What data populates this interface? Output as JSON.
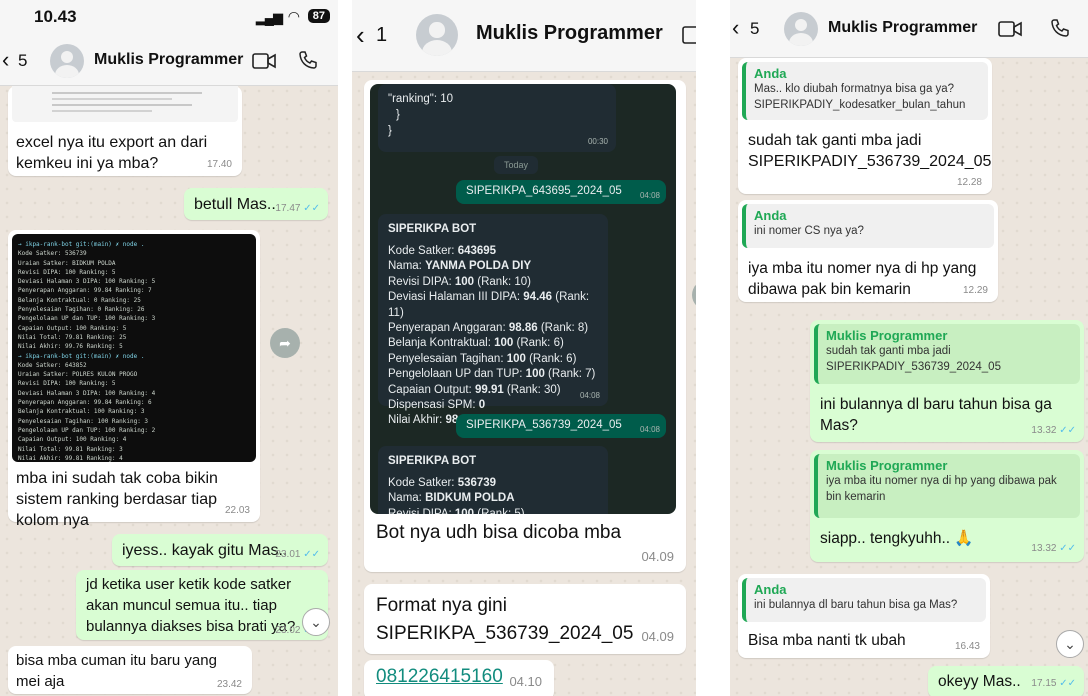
{
  "status": {
    "time": "10.43",
    "battery": "87"
  },
  "panel1": {
    "header": {
      "back_count": "5",
      "name": "Muklis Programmer"
    },
    "messages": {
      "m1": "excel nya itu export an dari kemkeu ini ya mba?",
      "m1_time": "17.40",
      "m2": "betull Mas..",
      "m2_time": "17.47",
      "m3": "mba ini sudah tak coba bikin sistem ranking berdasar tiap kolom nya",
      "m3_time": "22.03",
      "m4": "iyess.. kayak gitu Mas..",
      "m4_time": "23.01",
      "m5": "jd ketika user ketik kode satker akan muncul semua itu.. tiap bulannya diakses bisa brati ya?",
      "m5_time": "23.02",
      "m6": "bisa mba cuman itu baru yang mei aja",
      "m6_time": "23.42"
    },
    "terminal_lines": [
      "→ ikpa-rank-bot git:(main) ✗ node .",
      "Kode Satker: 536739",
      "Uraian Satker: BIDKUM POLDA",
      "Revisi DIPA: 100 Ranking: 5",
      "Deviasi Halaman 3 DIPA: 100 Ranking: 5",
      "Penyerapan Anggaran: 99.84 Ranking: 7",
      "Belanja Kontraktual: 0 Ranking: 25",
      "Penyelesaian Tagihan: 0 Ranking: 26",
      "Pengelolaan UP dan TUP: 100 Ranking: 3",
      "Capaian Output: 100 Ranking: 5",
      "Nilai Total: 79.81 Ranking: 25",
      "Nilai Akhir: 99.76 Ranking: 5",
      "→ ikpa-rank-bot git:(main) ✗ node .",
      "Kode Satker: 643852",
      "Uraian Satker: POLRES KULON PROGO",
      "Revisi DIPA: 100 Ranking: 5",
      "Deviasi Halaman 3 DIPA: 100 Ranking: 4",
      "Penyerapan Anggaran: 99.84 Ranking: 6",
      "Belanja Kontraktual: 100 Ranking: 3",
      "Penyelesaian Tagihan: 100 Ranking: 3",
      "Pengelolaan UP dan TUP: 100 Ranking: 2",
      "Capaian Output: 100 Ranking: 4",
      "Nilai Total: 99.81 Ranking: 3",
      "Nilai Akhir: 99.81 Ranking: 4",
      "→ ikpa-rank-bot git:(main) ✗ ▌"
    ]
  },
  "panel2": {
    "header": {
      "back_count": "1",
      "name": "Muklis Programmer"
    },
    "screenshot": {
      "top_code": "\"ranking\": 10",
      "top_brace1": "}",
      "top_brace2": "}",
      "top_time": "00:30",
      "today": "Today",
      "cmd1": "SIPERIKPA_643695_2024_05",
      "cmd1_time": "04:08",
      "bot_title": "SIPERIKPA BOT",
      "bot1": [
        [
          "Kode Satker: ",
          "643695",
          ""
        ],
        [
          "Nama: ",
          "YANMA POLDA DIY",
          ""
        ],
        [
          "Revisi DIPA: ",
          "100",
          " (Rank: 10)"
        ],
        [
          "Deviasi Halaman III DIPA: ",
          "94.46",
          " (Rank: 11)"
        ],
        [
          "Penyerapan Anggaran: ",
          "98.86",
          " (Rank: 8)"
        ],
        [
          "Belanja Kontraktual: ",
          "100",
          " (Rank: 6)"
        ],
        [
          "Penyelesaian Tagihan: ",
          "100",
          " (Rank: 6)"
        ],
        [
          "Pengelolaan UP dan TUP: ",
          "100",
          " (Rank: 7)"
        ],
        [
          "Capaian Output: ",
          "99.91",
          " (Rank: 30)"
        ],
        [
          "Dispensasi SPM: ",
          "0",
          ""
        ],
        [
          "Nilai Akhir: ",
          "98.92",
          " (Rank: 10)"
        ]
      ],
      "bot1_time": "04:08",
      "cmd2": "SIPERIKPA_536739_2024_05",
      "cmd2_time": "04:08",
      "bot2": [
        [
          "Kode Satker: ",
          "536739",
          ""
        ],
        [
          "Nama: ",
          "BIDKUM POLDA",
          ""
        ],
        [
          "Revisi DIPA: ",
          "100",
          " (Rank: 5)"
        ]
      ]
    },
    "messages": {
      "caption": "Bot nya udh bisa dicoba mba",
      "caption_time": "04.09",
      "format": "Format nya gini SIPERIKPA_536739_2024_05",
      "format_time": "04.09",
      "phone": "081226415160",
      "phone_time": "04.10"
    }
  },
  "panel3": {
    "header": {
      "back_count": "5",
      "name": "Muklis Programmer"
    },
    "messages": {
      "q1_author": "Anda",
      "q1_text": "Mas.. klo diubah formatnya bisa ga ya? SIPERIKPADIY_kodesatker_bulan_tahun",
      "r1": "sudah tak ganti mba jadi SIPERIKPADIY_536739_2024_05",
      "r1_time": "12.28",
      "q2_author": "Anda",
      "q2_text": "ini nomer CS nya ya?",
      "r2": "iya mba itu nomer nya di hp yang dibawa pak bin kemarin",
      "r2_time": "12.29",
      "q3_author": "Muklis Programmer",
      "q3_text": "sudah tak ganti mba jadi SIPERIKPADIY_536739_2024_05",
      "r3": "ini bulannya dl baru tahun bisa ga Mas?",
      "r3_time": "13.32",
      "q4_author": "Muklis Programmer",
      "q4_text": "iya mba itu nomer nya di hp yang dibawa pak bin kemarin",
      "r4": "siapp.. tengkyuhh.. 🙏",
      "r4_time": "13.32",
      "q5_author": "Anda",
      "q5_text": "ini bulannya dl baru tahun bisa ga Mas?",
      "r5": "Bisa mba nanti tk ubah",
      "r5_time": "16.43",
      "r6": "okeyy Mas..",
      "r6_time": "17.15"
    }
  }
}
